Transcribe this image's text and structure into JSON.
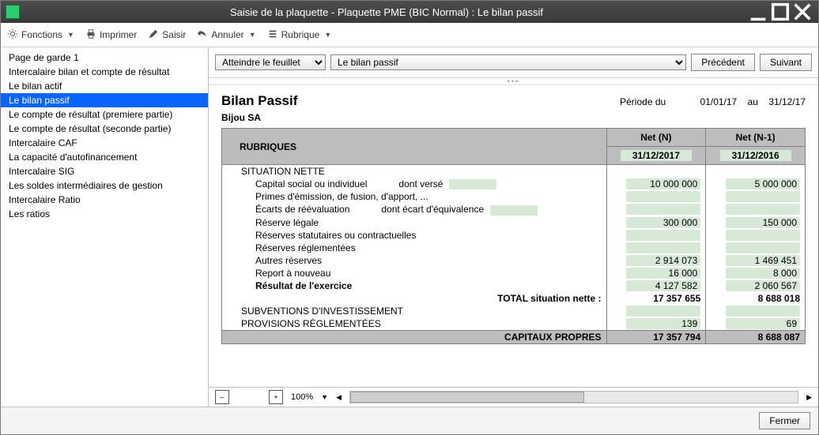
{
  "window_title": "Saisie de la plaquette - Plaquette PME (BIC Normal) :  Le bilan passif",
  "toolbar": {
    "fonctions": "Fonctions",
    "imprimer": "Imprimer",
    "saisir": "Saisir",
    "annuler": "Annuler",
    "rubrique": "Rubrique"
  },
  "sidebar": [
    "Page de garde 1",
    "Intercalaire bilan et compte de résultat",
    "Le bilan actif",
    "Le bilan passif",
    "Le compte de résultat (premiere partie)",
    "Le compte de résultat (seconde partie)",
    "Intercalaire CAF",
    "La capacité d'autofinancement",
    "Intercalaire SIG",
    "Les soldes intermédiaires de gestion",
    "Intercalaire Ratio",
    "Les ratios"
  ],
  "sidebar_selected_index": 3,
  "nav": {
    "goto_label": "Atteindre le feuillet",
    "sheet": "Le bilan passif",
    "prev": "Précédent",
    "next": "Suivant"
  },
  "report": {
    "title": "Bilan Passif",
    "period_label": "Période du",
    "period_from": "01/01/17",
    "period_sep": "au",
    "period_to": "31/12/17",
    "company": "Bijou SA",
    "columns": {
      "rub": "RUBRIQUES",
      "netN": "Net (N)",
      "netN1": "Net (N-1)",
      "dateN": "31/12/2017",
      "dateN1": "31/12/2016"
    },
    "rows": [
      {
        "label": "SITUATION NETTE",
        "cls": "ind1",
        "n": "",
        "n1": "",
        "plain": true
      },
      {
        "label": "Capital social ou individuel",
        "cls": "ind2",
        "anno": "dont versé",
        "fill": true,
        "n": "10 000 000",
        "n1": "5 000 000"
      },
      {
        "label": "Primes d'émission, de fusion, d'apport, ...",
        "cls": "ind2",
        "n": "",
        "n1": ""
      },
      {
        "label": "Écarts de réévaluation",
        "cls": "ind2",
        "anno": "dont écart d'équivalence",
        "fill": true,
        "n": "",
        "n1": ""
      },
      {
        "label": "Réserve légale",
        "cls": "ind2",
        "n": "300 000",
        "n1": "150 000"
      },
      {
        "label": "Réserves statutaires ou contractuelles",
        "cls": "ind2",
        "n": "",
        "n1": ""
      },
      {
        "label": "Réserves réglementées",
        "cls": "ind2",
        "n": "",
        "n1": ""
      },
      {
        "label": "Autres réserves",
        "cls": "ind2",
        "n": "2 914 073",
        "n1": "1 469 451"
      },
      {
        "label": "Report à nouveau",
        "cls": "ind2",
        "n": "16 000",
        "n1": "8 000"
      },
      {
        "label": "Résultat de l'exercice",
        "cls": "ind2",
        "bold": true,
        "n": "4 127 582",
        "n1": "2 060 567"
      },
      {
        "label": "TOTAL situation nette :",
        "cls": "rt",
        "subtotal": true,
        "n": "17 357 655",
        "n1": "8 688 018"
      },
      {
        "label": "SUBVENTIONS D'INVESTISSEMENT",
        "cls": "ind1",
        "n": "",
        "n1": ""
      },
      {
        "label": "PROVISIONS RÉGLEMENTÉES",
        "cls": "ind1",
        "n": "139",
        "n1": "69"
      },
      {
        "label": "CAPITAUX PROPRES",
        "cls": "rt",
        "total": true,
        "n": "17 357 794",
        "n1": "8 688 087"
      }
    ]
  },
  "status": {
    "zoom": "100%"
  },
  "footer": {
    "close": "Fermer"
  }
}
